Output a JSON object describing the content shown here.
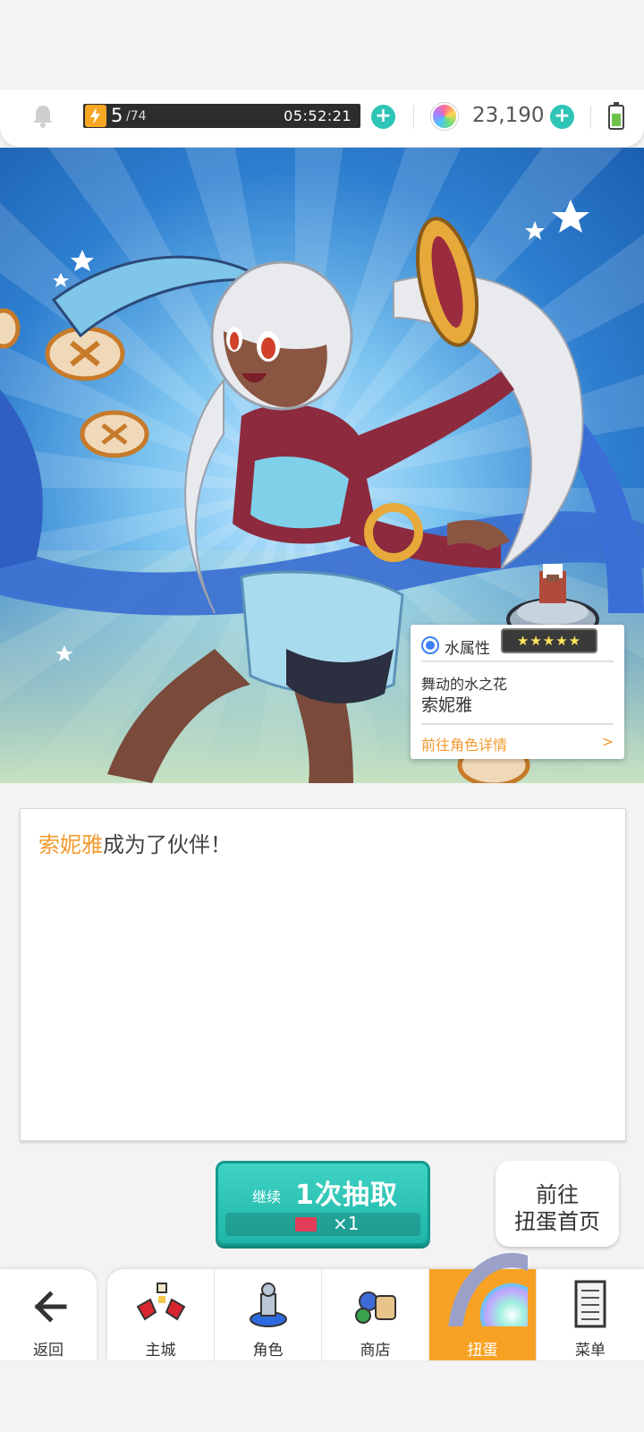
{
  "topbar": {
    "stamina_current": "5",
    "stamina_max": "/74",
    "stamina_timer": "05:52:21",
    "gems": "23,190"
  },
  "result_card": {
    "attribute": "水属性",
    "stars": "★★★★★",
    "subtitle": "舞动的水之花",
    "name": "索妮雅",
    "detail_link": "前往角色详情",
    "detail_arrow": ">"
  },
  "message": {
    "highlight": "索妮雅",
    "text": "成为了伙伴！"
  },
  "pull_button": {
    "prefix": "继续",
    "label": "1次抽取",
    "cost": "×1"
  },
  "home_button": {
    "line1": "前往",
    "line2": "扭蛋首页"
  },
  "back": {
    "label": "返回"
  },
  "nav": {
    "items": [
      {
        "label": "主城",
        "icon": "castle-icon"
      },
      {
        "label": "角色",
        "icon": "character-icon"
      },
      {
        "label": "商店",
        "icon": "shop-icon"
      },
      {
        "label": "扭蛋",
        "icon": "gacha-icon",
        "active": true
      },
      {
        "label": "菜单",
        "icon": "menu-icon"
      }
    ]
  },
  "colors": {
    "accent_orange": "#f29a2e",
    "teal": "#2ec4b6",
    "active_tab": "#f7a224"
  }
}
